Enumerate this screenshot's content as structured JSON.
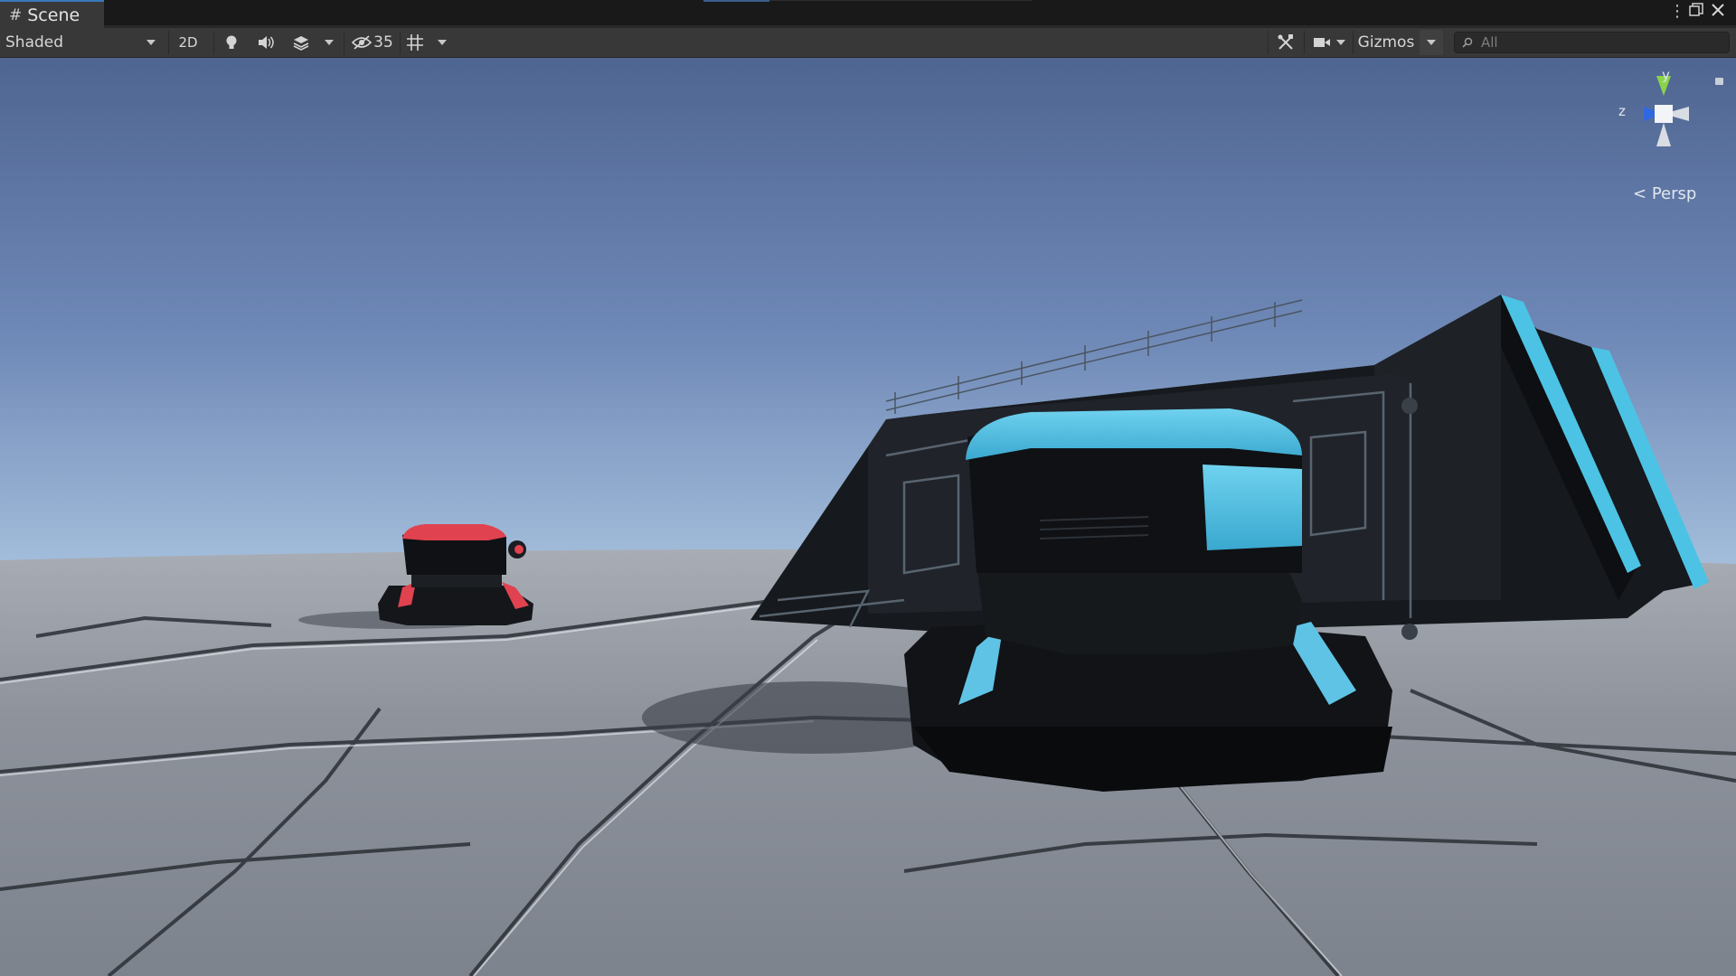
{
  "window": {
    "tab_title": "Scene",
    "menu_icon": "kebab-menu-icon",
    "maximize_icon": "maximize-icon",
    "close_icon": "close-icon"
  },
  "toolbar": {
    "shading_mode": "Shaded",
    "mode_2d": "2D",
    "lighting_icon": "lightbulb-icon",
    "audio_icon": "speaker-icon",
    "effects_icon": "layers-icon",
    "hidden_count": "35",
    "grid_icon": "grid-icon",
    "tools_icon": "tools-icon",
    "camera_icon": "camera-icon",
    "gizmos_label": "Gizmos",
    "search_placeholder": "All"
  },
  "scene": {
    "axis_y": "y",
    "axis_z": "z",
    "projection": "Persp",
    "colors": {
      "sky_top": "#4f6591",
      "horizon": "#dfeef7",
      "ground": "#8d929b",
      "turret_red": "#e0424f",
      "turret_blue": "#4dc3e6"
    }
  }
}
